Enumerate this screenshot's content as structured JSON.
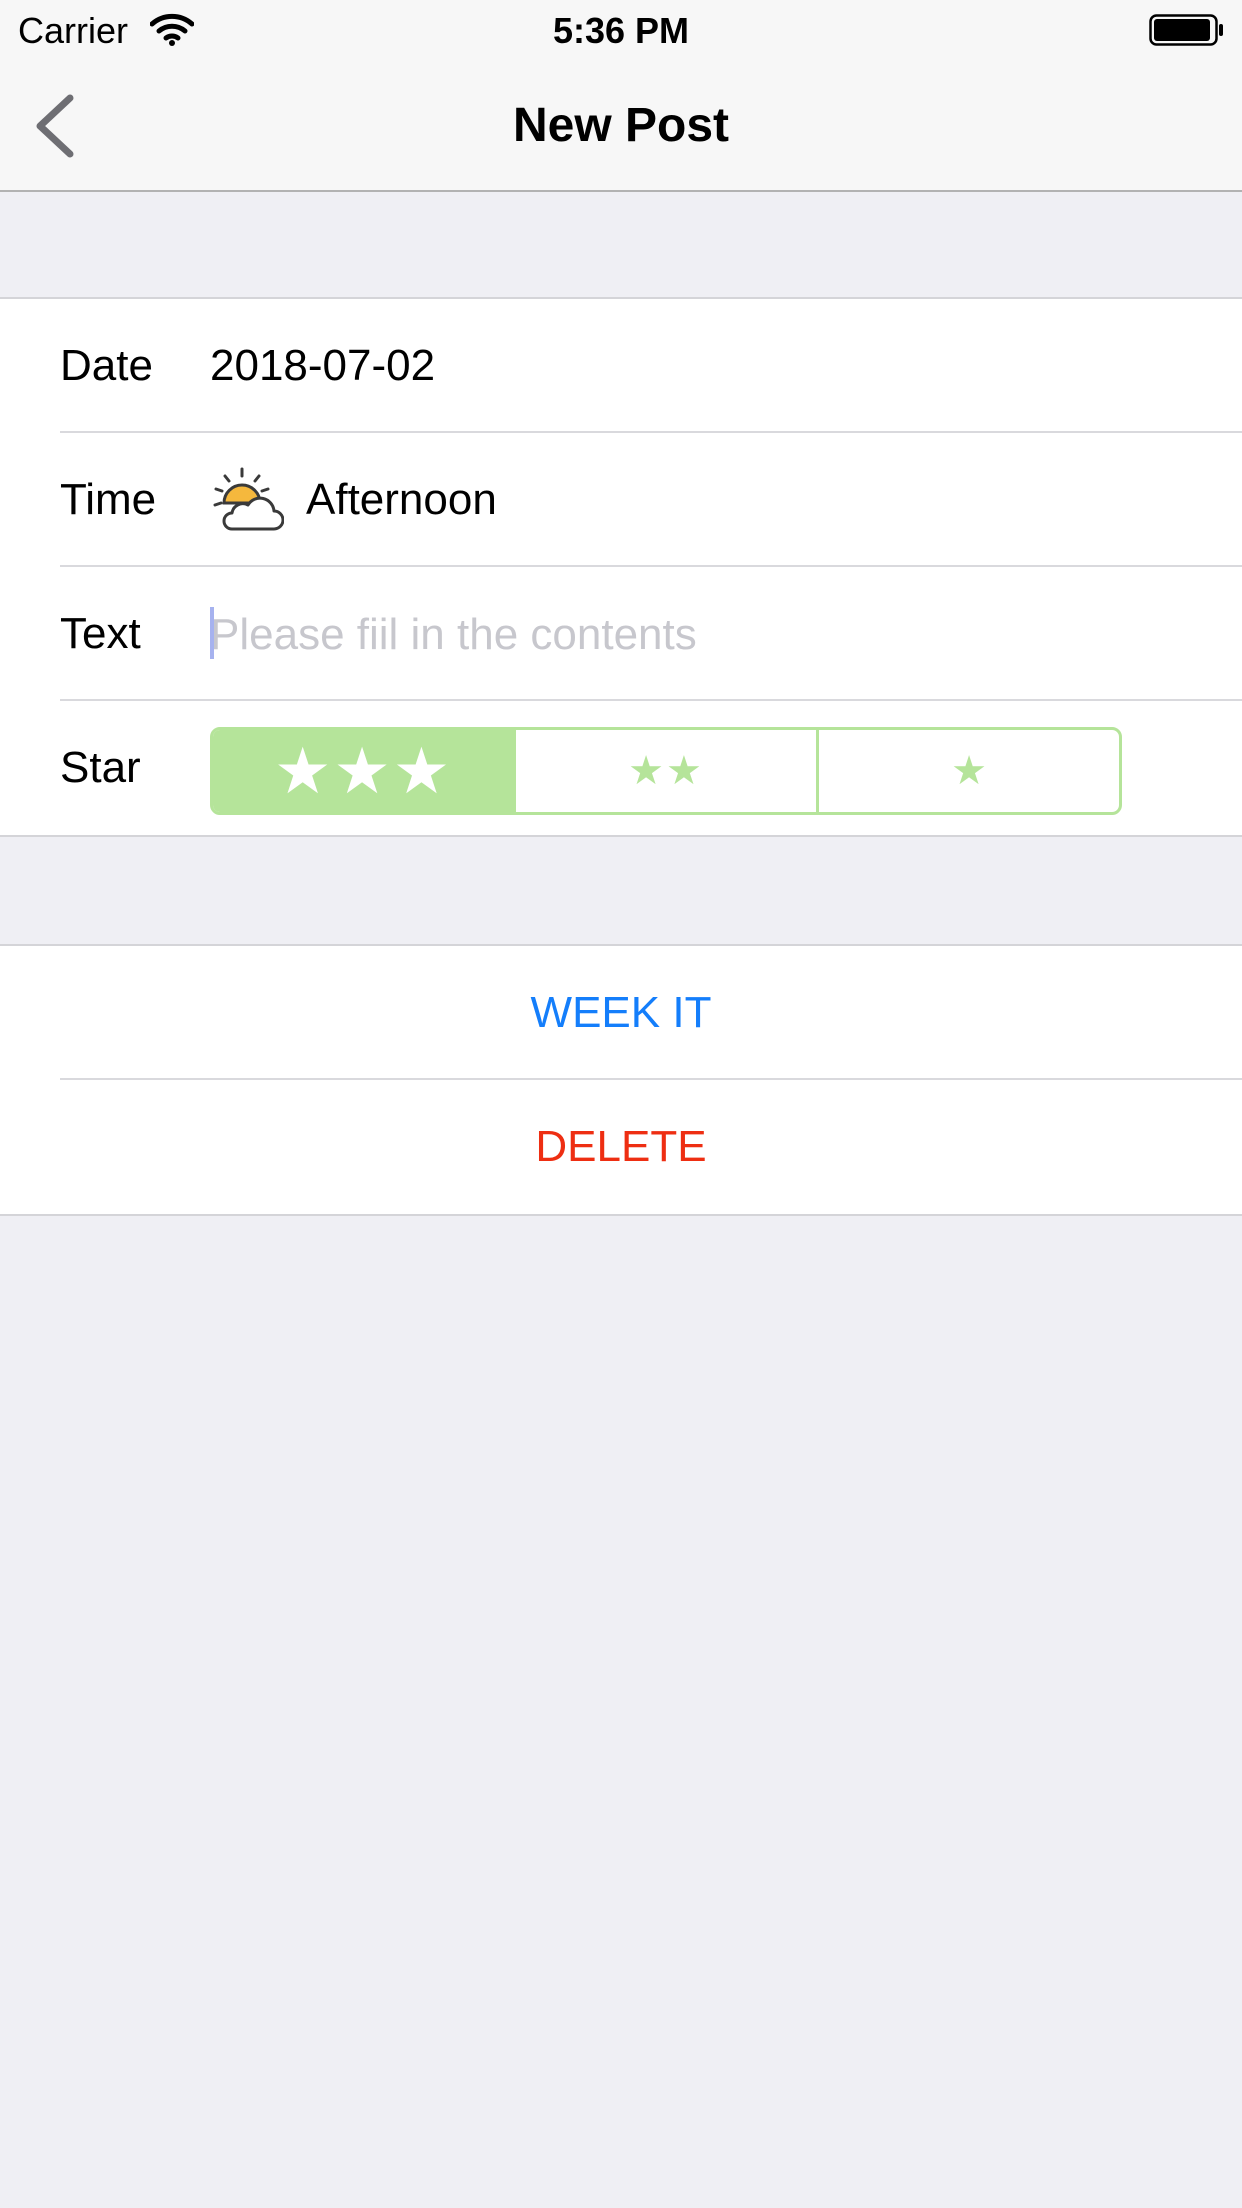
{
  "status_bar": {
    "carrier": "Carrier",
    "time": "5:36 PM"
  },
  "nav": {
    "title": "New Post",
    "back_icon": "chevron-left-icon"
  },
  "form": {
    "date": {
      "label": "Date",
      "value": "2018-07-02"
    },
    "time": {
      "label": "Time",
      "value": "Afternoon",
      "icon": "sun-cloud-icon"
    },
    "text": {
      "label": "Text",
      "value": "",
      "placeholder": "Please fiil in the contents"
    },
    "star": {
      "label": "Star",
      "options": [
        "★★★",
        "★★",
        "★"
      ],
      "selected_index": 0
    }
  },
  "actions": {
    "week_it": "WEEK IT",
    "delete": "DELETE"
  },
  "colors": {
    "accent_blue": "#147efb",
    "destructive_red": "#ee2e12",
    "segment_green": "#b5e49a",
    "icon_sun": "#f5b83d"
  }
}
